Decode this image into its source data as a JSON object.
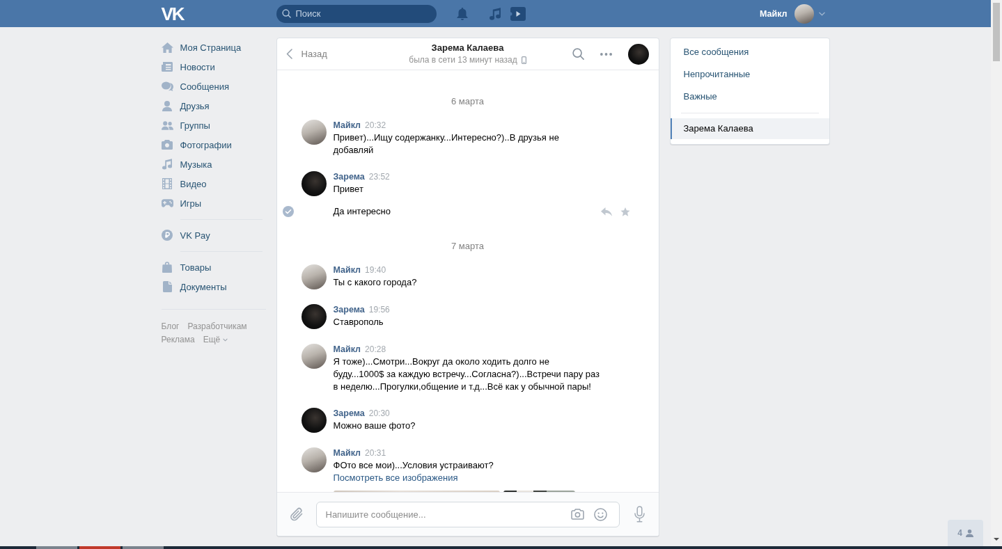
{
  "header": {
    "logo": "VK",
    "search": {
      "placeholder": "Поиск"
    },
    "user_name": "Майкл"
  },
  "sidebar": {
    "groups": [
      {
        "items": [
          {
            "label": "Моя Страница",
            "selected": false
          },
          {
            "label": "Новости",
            "selected": false
          },
          {
            "label": "Сообщения",
            "selected": false
          },
          {
            "label": "Друзья",
            "selected": false
          },
          {
            "label": "Группы",
            "selected": false
          },
          {
            "label": "Фотографии",
            "selected": false
          },
          {
            "label": "Музыка",
            "selected": false
          },
          {
            "label": "Видео",
            "selected": false
          },
          {
            "label": "Игры",
            "selected": false
          }
        ]
      },
      {
        "items": [
          {
            "label": "VK Pay",
            "selected": false
          }
        ]
      },
      {
        "items": [
          {
            "label": "Товары",
            "selected": false
          },
          {
            "label": "Документы",
            "selected": false
          }
        ]
      }
    ],
    "footer_links": [
      {
        "label": "Блог",
        "dropdown": false
      },
      {
        "label": "Разработчикам",
        "dropdown": false
      },
      {
        "label": "Реклама",
        "dropdown": false
      },
      {
        "label": "Ещё",
        "dropdown": true
      }
    ]
  },
  "chat": {
    "back": "Назад",
    "title": "Зарема Калаева",
    "status": "была в сети 13 минут назад",
    "timeline": [
      {
        "kind": "date",
        "text": "6 марта"
      },
      {
        "kind": "message",
        "author": "Майкл",
        "from_me": true,
        "time": "20:32",
        "text": "Привет)...Ищу содержанку...Интересно?)..В друзья не\nдобавляй"
      },
      {
        "kind": "message",
        "author": "Зарема",
        "from_me": false,
        "time": "23:52",
        "text": "Привет"
      },
      {
        "kind": "continuation",
        "text": "Да интересно",
        "hovered": true
      },
      {
        "kind": "date",
        "text": "7 марта"
      },
      {
        "kind": "message",
        "author": "Майкл",
        "from_me": true,
        "time": "19:40",
        "text": "Ты с какого города?"
      },
      {
        "kind": "message",
        "author": "Зарема",
        "from_me": false,
        "time": "19:56",
        "text": "Ставрополь"
      },
      {
        "kind": "message",
        "author": "Майкл",
        "from_me": true,
        "time": "20:28",
        "text": "Я тоже)...Смотри...Вокруг да около ходить долго не\nбуду...1000$ за каждую встречу...Согласна?)...Встречи пару раз\nв неделю...Прогулки,общение и т.д...Всё как у обычной пары!"
      },
      {
        "kind": "message",
        "author": "Зарема",
        "from_me": false,
        "time": "20:30",
        "text": "Можно ваше фото?"
      },
      {
        "kind": "message",
        "author": "Майкл",
        "from_me": true,
        "time": "20:31",
        "text": "ФОто все мои)...Условия устраивают?",
        "link": "Посмотреть все изображения",
        "attachments": [
          {
            "kind": "photo"
          },
          {
            "kind": "photo"
          }
        ]
      }
    ],
    "composer": {
      "placeholder": "Напишите сообщение..."
    }
  },
  "message_filters": {
    "items": [
      {
        "label": "Все сообщения",
        "selected": false
      },
      {
        "label": "Непрочитанные",
        "selected": false
      },
      {
        "label": "Важные",
        "selected": false
      }
    ],
    "open_chats": [
      {
        "label": "Зарема Калаева",
        "selected": true
      }
    ]
  },
  "online_button": {
    "count": "4"
  }
}
